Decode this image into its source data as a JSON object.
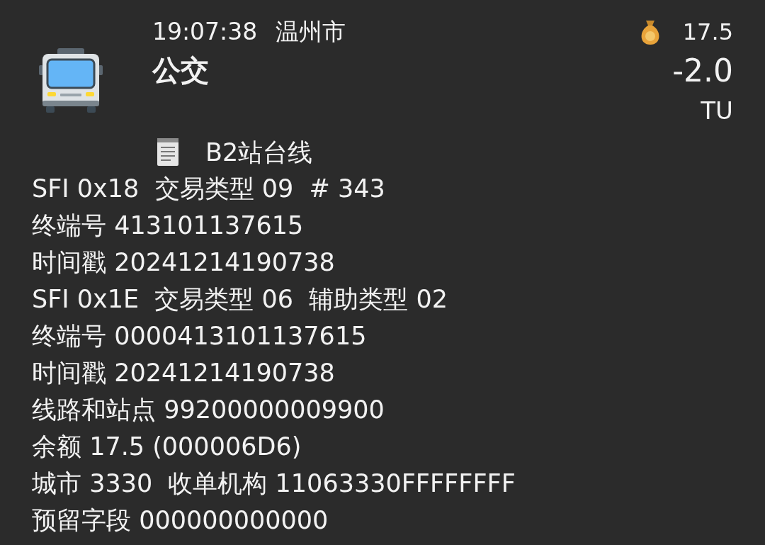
{
  "header": {
    "time": "19:07:38",
    "city": "温州市",
    "type": "公交",
    "balance": "17.5",
    "amount": "-2.0",
    "currency": "TU"
  },
  "note": "B2站台线",
  "records": [
    "SFI 0x18  交易类型 09  # 343",
    "终端号 413101137615",
    "时间戳 20241214190738",
    "SFI 0x1E  交易类型 06  辅助类型 02",
    "终端号 0000413101137615",
    "时间戳 20241214190738",
    "线路和站点 99200000009900",
    "余额 17.5 (000006D6)",
    "城市 3330  收单机构 11063330FFFFFFFF",
    "预留字段 000000000000"
  ]
}
